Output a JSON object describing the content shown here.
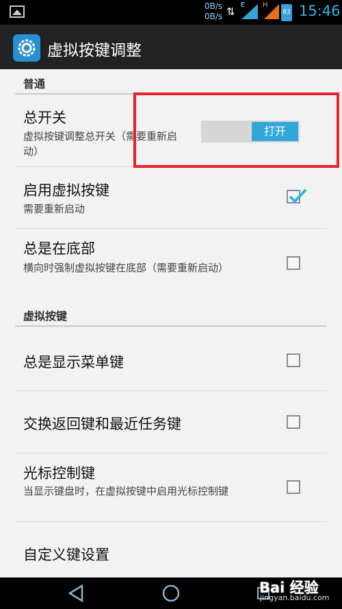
{
  "status_bar": {
    "net_up": "0B/s",
    "net_down": "0B/s",
    "net_type_1": "E",
    "net_type_2": "H",
    "battery": "83",
    "time": "15:46"
  },
  "action_bar": {
    "title": "虚拟按键调整",
    "icon": "gear-icon"
  },
  "categories": {
    "general": "普通",
    "virtual_keys": "虚拟按键"
  },
  "preferences": {
    "master_switch": {
      "title": "总开关",
      "summary": "虚拟按键调整总开关（需要重新启动）",
      "switch_label": "打开"
    },
    "enable_virtual_keys": {
      "title": "启用虚拟按键",
      "summary": "需要重新启动",
      "checked": true
    },
    "always_bottom": {
      "title": "总是在底部",
      "summary": "横向时强制虚拟按键在底部（需要重新启动）",
      "checked": false
    },
    "always_show_menu": {
      "title": "总是显示菜单键",
      "checked": false
    },
    "swap_back_recent": {
      "title": "交换返回键和最近任务键",
      "checked": false
    },
    "cursor_keys": {
      "title": "光标控制键",
      "summary": "当显示键盘时，在虚拟按键中启用光标控制键",
      "checked": false
    },
    "custom_keys": {
      "title": "自定义键设置"
    }
  },
  "watermark": {
    "brand": "Bai 经验",
    "url": "jingyan.baidu.com"
  },
  "colors": {
    "accent": "#33b5e5",
    "highlight_box": "#e8222a",
    "action_bar": "#222222"
  }
}
